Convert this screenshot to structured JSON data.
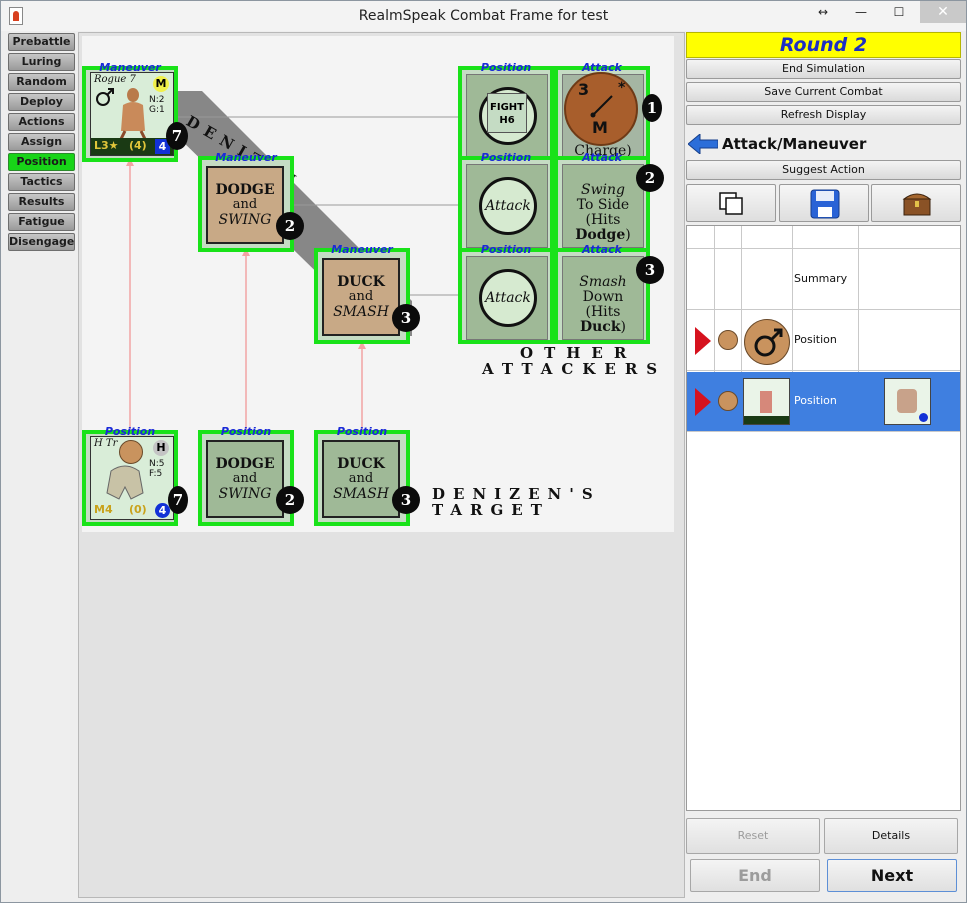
{
  "window": {
    "title": "RealmSpeak Combat Frame for test",
    "controls": {
      "restore": "↔",
      "minimize": "—",
      "maximize": "☐",
      "close": "✕"
    }
  },
  "left_nav": {
    "items": [
      "Prebattle",
      "Luring",
      "Random",
      "Deploy",
      "Actions",
      "Assign",
      "Position",
      "Tactics",
      "Results",
      "Fatigue",
      "Disengage"
    ],
    "active": "Position",
    "active_color": "#18d418"
  },
  "board": {
    "denizen_label": "DENIZEN",
    "other_attackers_line1": "OTHER",
    "other_attackers_line2": "ATTACKERS",
    "target_line1": "DENIZEN'S",
    "target_line2": "TARGET",
    "denizen_row": [
      {
        "slot_label": "Maneuver",
        "card": {
          "name": "Rogue 7",
          "badge": "M",
          "stats1": "N:2",
          "stats2": "G:1",
          "bottom_left": "L3★",
          "bottom_mid": "(4)",
          "bottom_num": "4"
        },
        "speed": "7"
      },
      {
        "slot_label": "Maneuver",
        "line1": "DODGE",
        "line2": "and",
        "line3": "SWING",
        "speed": "2"
      },
      {
        "slot_label": "Maneuver",
        "line1": "DUCK",
        "line2": "and",
        "line3": "SMASH",
        "speed": "3"
      }
    ],
    "attackers": [
      {
        "pos_label": "Position",
        "pos_text1": "FIGHT",
        "pos_text2": "H6",
        "atk_label": "Attack",
        "token_top": "3",
        "token_star": "*",
        "token_bottom": "M",
        "atk_text_tail": "(Hits Charge)",
        "speed": "1"
      },
      {
        "pos_label": "Position",
        "pos_text": "Attack",
        "atk_label": "Attack",
        "atk_text1": "Swing",
        "atk_text2": "To Side",
        "atk_text3_pre": "(Hits ",
        "atk_text3_bold": "Dodge",
        "atk_text3_post": ")",
        "speed": "2"
      },
      {
        "pos_label": "Position",
        "pos_text": "Attack",
        "atk_label": "Attack",
        "atk_text1": "Smash",
        "atk_text2": "Down",
        "atk_text3_pre": "(Hits ",
        "atk_text3_bold": "Duck",
        "atk_text3_post": ")",
        "speed": "3"
      }
    ],
    "target_row": [
      {
        "slot_label": "Position",
        "card": {
          "name": "H Tr",
          "badge": "H",
          "stats1": "N:5",
          "stats2": "F:5",
          "bottom_left": "M4",
          "bottom_mid": "(0)",
          "bottom_num": "4"
        },
        "speed": "7"
      },
      {
        "slot_label": "Position",
        "line1": "DODGE",
        "line2": "and",
        "line3": "SWING",
        "speed": "2"
      },
      {
        "slot_label": "Position",
        "line1": "DUCK",
        "line2": "and",
        "line3": "SMASH",
        "speed": "3"
      }
    ]
  },
  "right_panel": {
    "round": "Round 2",
    "round_bg": "#ffff00",
    "buttons": {
      "end_simulation": "End Simulation",
      "save_combat": "Save Current Combat",
      "refresh": "Refresh Display"
    },
    "action_title": "Attack/Maneuver",
    "suggest": "Suggest Action",
    "icon_buttons": [
      "copy-icon",
      "save-disk-icon",
      "treasure-chest-icon"
    ],
    "grid": {
      "rows": [
        {
          "label": "Summary"
        },
        {
          "label": "Position"
        },
        {
          "label": "Position",
          "selected": true
        }
      ],
      "selected_color": "#3f7fe0"
    },
    "reset": "Reset",
    "details": "Details",
    "end": "End",
    "next": "Next"
  }
}
